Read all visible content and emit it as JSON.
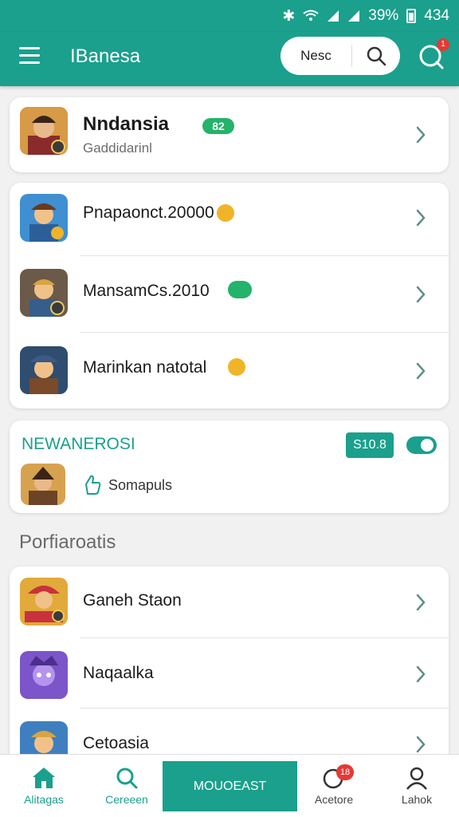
{
  "status_bar": {
    "battery": "39%",
    "time": "434"
  },
  "app_bar": {
    "title": "IBanesa",
    "search_pill_label": "Nesc"
  },
  "help_badge": {
    "count": "1"
  },
  "profile_card": {
    "name": "Nndansia",
    "badge": "82",
    "subtitle": "Gaddidarinl"
  },
  "game_list": [
    {
      "label": "Pnapaonct.20000",
      "badge_color": "#f0b429"
    },
    {
      "label": "MansamCs.2010",
      "badge_color": "#23b36a"
    },
    {
      "label": "Marinkan natotal",
      "badge_color": "#f0b429"
    }
  ],
  "news_card": {
    "title": "NEWANEROSI",
    "price": "S10.8",
    "item_label": "Somapuls"
  },
  "section": {
    "title": "Porfiaroatis"
  },
  "portfolio_list": [
    {
      "label": "Ganeh Staon"
    },
    {
      "label": "Naqaalka"
    },
    {
      "label": "Cetoasia"
    }
  ],
  "bottom_nav": {
    "home": "Alitagas",
    "search": "Cereeen",
    "center": "MOUOEAST",
    "activity": "Acetore",
    "activity_badge": "18",
    "profile": "Lahok"
  },
  "colors": {
    "accent": "#1aa08c",
    "badge_green": "#23b36a",
    "badge_orange": "#f0b429",
    "notification_red": "#e53935"
  }
}
